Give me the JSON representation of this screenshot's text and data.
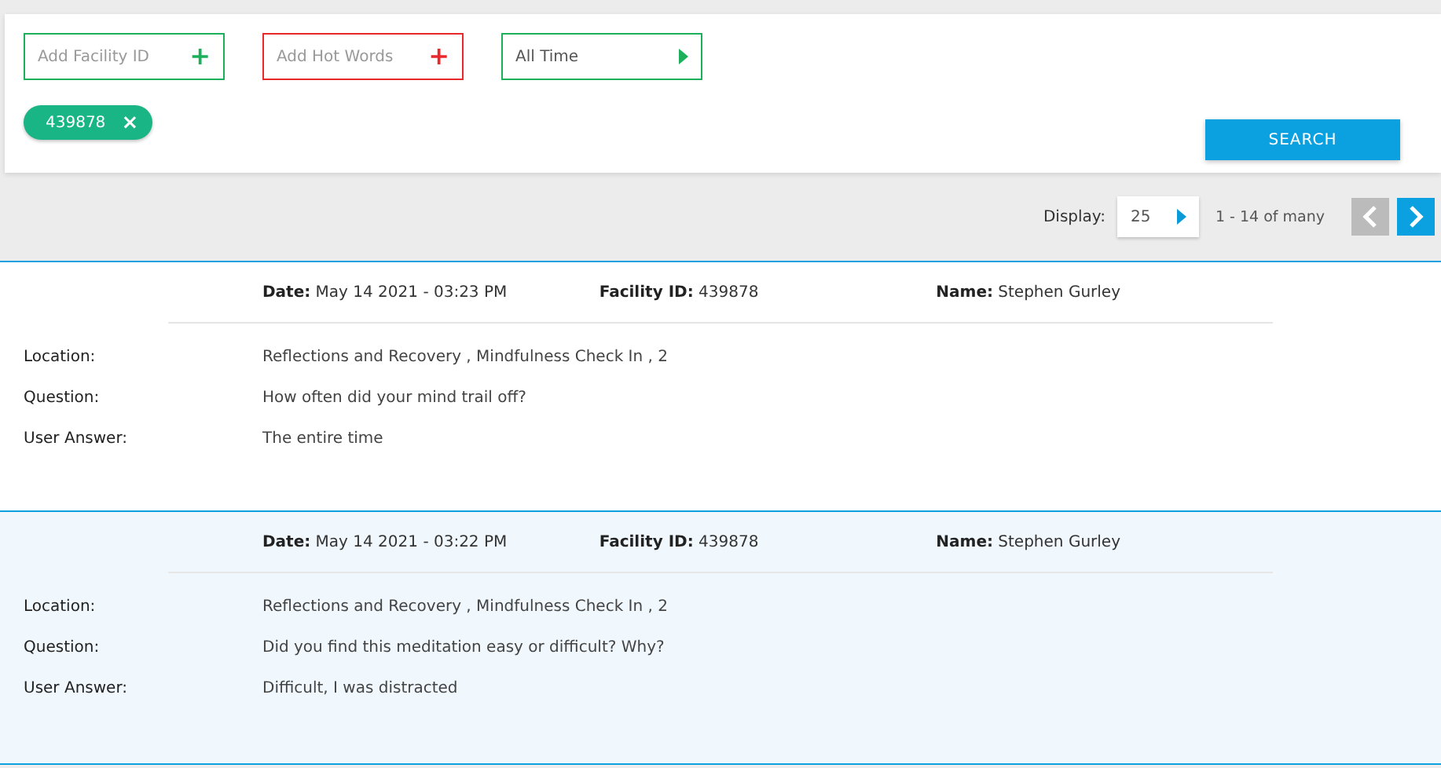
{
  "filters": [
    {
      "kind": "add",
      "placeholder": "Add Facility ID",
      "color": "#1db05a",
      "icon": "+"
    },
    {
      "kind": "add",
      "placeholder": "Add Hot Words",
      "color": "#e8282b",
      "icon": "+"
    },
    {
      "kind": "select",
      "value": "All Time",
      "color": "#1db05a"
    }
  ],
  "chips": [
    {
      "label": "439878",
      "remove": "×"
    }
  ],
  "search_button": "SEARCH",
  "pagination": {
    "label": "Display:",
    "page_size": "25",
    "range": "1 - 14 of many",
    "prev_disabled": true,
    "next_disabled": false
  },
  "records": [
    {
      "selected": false,
      "header": [
        "**Date:** May 14 2021 - 03:23 PM",
        "**Facility ID:** 439878",
        "**Name:** Stephen Gurley"
      ],
      "fields": [
        {
          "label": "Location:",
          "value": "Reflections and Recovery , Mindfulness Check In , 2"
        },
        {
          "label": "Question:",
          "value": "How often did your mind trail off?"
        },
        {
          "label": "User Answer:",
          "value": "The entire time"
        }
      ]
    },
    {
      "selected": true,
      "header": [
        "**Date:** May 14 2021 - 03:22 PM",
        "**Facility ID:** 439878",
        "**Name:** Stephen Gurley"
      ],
      "fields": [
        {
          "label": "Location:",
          "value": "Reflections and Recovery , Mindfulness Check In , 2"
        },
        {
          "label": "Question:",
          "value": "Did you find this meditation easy or difficult? Why?"
        },
        {
          "label": "User Answer:",
          "value": "Difficult, I was distracted"
        }
      ]
    }
  ]
}
